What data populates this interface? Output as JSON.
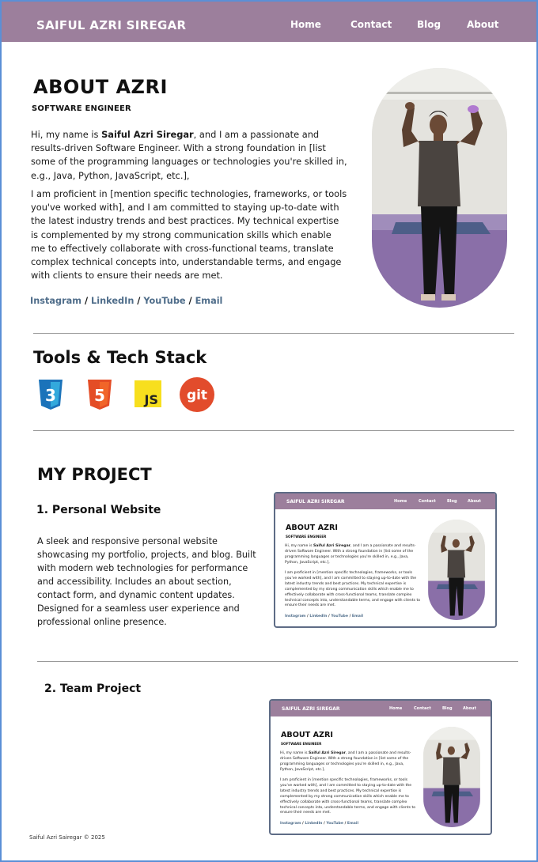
{
  "nav": {
    "brand": "SAIFUL AZRI SIREGAR",
    "links": [
      "Home",
      "Contact",
      "Blog",
      "About"
    ]
  },
  "about": {
    "title": "ABOUT AZRI",
    "subtitle": "SOFTWARE ENGINEER",
    "para1_prefix": "Hi, my name is ",
    "para1_name": "Saiful Azri Siregar",
    "para1_suffix": ", and I am a passionate and results-driven Software Engineer. With a strong foundation in [list some of the programming languages or technologies you're skilled in, e.g., Java, Python, JavaScript, etc.],",
    "para2": "I am proficient in [mention specific technologies, frameworks, or tools you've worked with], and I am committed to staying up-to-date with the latest industry trends and best practices. My technical expertise is complemented by my strong communication skills which enable me to effectively collaborate with cross-functional teams, translate complex technical concepts into, understandable terms, and engage with clients to ensure their needs are met.",
    "social": [
      "Instagram",
      "LinkedIn",
      "YouTube",
      "Email"
    ],
    "separator": " / "
  },
  "tools": {
    "title": "Tools & Tech Stack",
    "icons": [
      "css3-icon",
      "html5-icon",
      "javascript-icon",
      "git-icon"
    ],
    "js_text": "JS",
    "git_text": "git",
    "css_num": "3",
    "html_num": "5"
  },
  "projects": {
    "title": "MY PROJECT",
    "items": [
      {
        "title": "1. Personal Website",
        "description": "A sleek and responsive personal website showcasing my portfolio, projects, and blog. Built with modern web technologies for performance and accessibility. Includes an about section, contact form, and dynamic content updates. Designed for a seamless user experience and professional online presence."
      },
      {
        "title": "2. Team Project"
      }
    ]
  },
  "footer": {
    "text": "Saiful Azri Sairegar © 2025"
  },
  "colors": {
    "nav": "#9c7f9c",
    "link": "#4f6d8a",
    "frame": "#5b8fd6"
  }
}
